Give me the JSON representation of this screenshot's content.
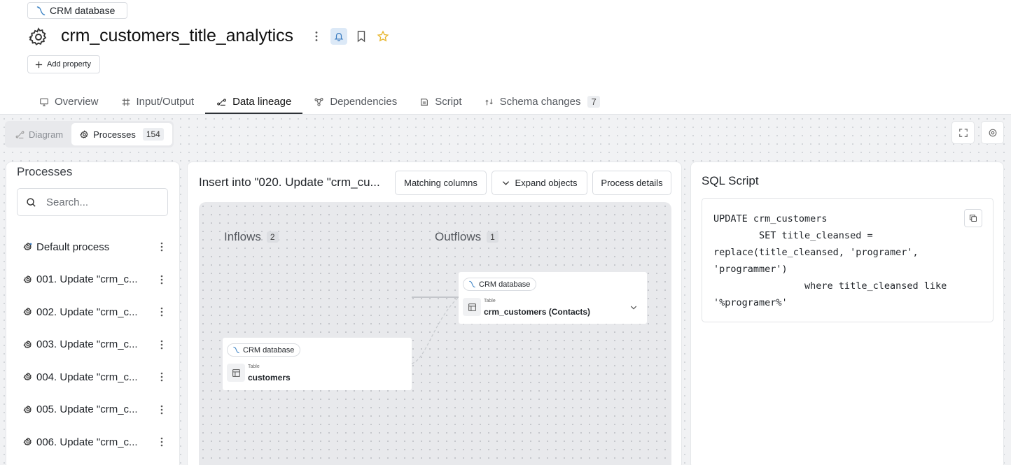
{
  "header": {
    "db_chip": "CRM database",
    "title": "crm_customers_title_analytics",
    "add_property": "Add property",
    "star_color": "#e8b62d",
    "bell_bg": "#dce9f7"
  },
  "tabs": [
    {
      "label": "Overview",
      "icon": "monitor-icon"
    },
    {
      "label": "Input/Output",
      "icon": "io-icon"
    },
    {
      "label": "Data lineage",
      "icon": "lineage-icon",
      "active": true
    },
    {
      "label": "Dependencies",
      "icon": "dependencies-icon"
    },
    {
      "label": "Script",
      "icon": "script-icon"
    },
    {
      "label": "Schema changes",
      "icon": "schema-icon",
      "count": "7"
    }
  ],
  "subtabs": {
    "diagram": "Diagram",
    "processes": "Processes",
    "processes_count": "154"
  },
  "left_panel": {
    "title": "Processes",
    "search_placeholder": "Search...",
    "items": [
      {
        "label": "Default process"
      },
      {
        "label": "001. Update \"crm_c..."
      },
      {
        "label": "002. Update \"crm_c..."
      },
      {
        "label": "003. Update \"crm_c..."
      },
      {
        "label": "004. Update \"crm_c..."
      },
      {
        "label": "005. Update \"crm_c..."
      },
      {
        "label": "006. Update \"crm_c..."
      }
    ]
  },
  "middle_panel": {
    "title": "Insert into \"020. Update \"crm_cu...",
    "matching_columns": "Matching columns",
    "expand_objects": "Expand objects",
    "process_details": "Process details",
    "inflows_label": "Inflows",
    "inflows_count": "2",
    "outflows_label": "Outflows",
    "outflows_count": "1",
    "inflow_node": {
      "db": "CRM database",
      "type": "Table",
      "name": "customers"
    },
    "outflow_node": {
      "db": "CRM database",
      "type": "Table",
      "name": "crm_customers (Contacts)"
    }
  },
  "right_panel": {
    "title": "SQL Script",
    "code": "UPDATE crm_customers\n        SET title_cleansed =\nreplace(title_cleansed, 'programer',\n'programmer')\n                where title_cleansed like\n'%programer%'"
  }
}
